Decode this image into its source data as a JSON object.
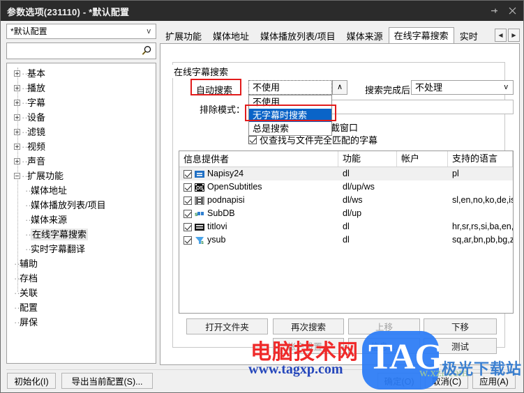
{
  "window": {
    "title": "参数选项(231110) - *默认配置",
    "pin_icon": "pin-icon",
    "close_icon": "close-icon"
  },
  "sidebar": {
    "profile_combo": {
      "value": "*默认配置",
      "arrow": "v"
    },
    "search": {
      "placeholder": "",
      "value": "",
      "icon": "search-icon"
    },
    "tree": [
      {
        "label": "基本",
        "expander": "plus",
        "level": 0
      },
      {
        "label": "播放",
        "expander": "plus",
        "level": 0
      },
      {
        "label": "字幕",
        "expander": "plus",
        "level": 0
      },
      {
        "label": "设备",
        "expander": "plus",
        "level": 0
      },
      {
        "label": "滤镜",
        "expander": "plus",
        "level": 0
      },
      {
        "label": "视频",
        "expander": "plus",
        "level": 0
      },
      {
        "label": "声音",
        "expander": "plus",
        "level": 0
      },
      {
        "label": "扩展功能",
        "expander": "minus",
        "level": 0
      },
      {
        "label": "媒体地址",
        "expander": "none",
        "level": 1
      },
      {
        "label": "媒体播放列表/项目",
        "expander": "none",
        "level": 1
      },
      {
        "label": "媒体来源",
        "expander": "none",
        "level": 1
      },
      {
        "label": "在线字幕搜索",
        "expander": "none",
        "level": 1,
        "selected": true
      },
      {
        "label": "实时字幕翻译",
        "expander": "none",
        "level": 1
      },
      {
        "label": "辅助",
        "expander": "none",
        "level": 0
      },
      {
        "label": "存档",
        "expander": "none",
        "level": 0
      },
      {
        "label": "关联",
        "expander": "none",
        "level": 0
      },
      {
        "label": "配置",
        "expander": "none",
        "level": 0
      },
      {
        "label": "屏保",
        "expander": "none",
        "level": 0
      }
    ]
  },
  "tabs": {
    "items": [
      {
        "label": "扩展功能",
        "active": false
      },
      {
        "label": "媒体地址",
        "active": false
      },
      {
        "label": "媒体播放列表/项目",
        "active": false
      },
      {
        "label": "媒体来源",
        "active": false
      },
      {
        "label": "在线字幕搜索",
        "active": true
      },
      {
        "label": "实时",
        "active": false
      }
    ],
    "scroll_left": "◀",
    "scroll_right": "▶"
  },
  "panel": {
    "group_title": "在线字幕搜索",
    "auto_search_label": "自动搜索",
    "auto_search_value": "不使用",
    "auto_search_arrow": "∧",
    "after_search_label": "搜索完成后：",
    "after_search_value": "不处理",
    "after_search_arrow": "v",
    "exclude_label": "排除模式：",
    "exclude_value": "",
    "partial_text": "截窗口",
    "exact_match_label": "仅查找与文件完全匹配的字幕",
    "exact_match_checked": true,
    "dropdown_options": [
      {
        "label": "不使用",
        "selected": false
      },
      {
        "label": "无字幕时搜索",
        "selected": true
      },
      {
        "label": "总是搜索",
        "selected": false
      }
    ]
  },
  "providers": {
    "columns": [
      "信息提供者",
      "功能",
      "帐户",
      "支持的语言"
    ],
    "rows": [
      {
        "checked": true,
        "icon": "napisy24-icon",
        "name": "Napisy24",
        "functions": "dl",
        "account": "",
        "languages": "pl"
      },
      {
        "checked": true,
        "icon": "opensubtitles-icon",
        "name": "OpenSubtitles",
        "functions": "dl/up/ws",
        "account": "",
        "languages": ""
      },
      {
        "checked": true,
        "icon": "podnapisi-icon",
        "name": "podnapisi",
        "functions": "dl/ws",
        "account": "",
        "languages": "sl,en,no,ko,de,is,cs,fr,it,b..."
      },
      {
        "checked": true,
        "icon": "subdb-icon",
        "name": "SubDB",
        "functions": "dl/up",
        "account": "",
        "languages": ""
      },
      {
        "checked": true,
        "icon": "titlovi-icon",
        "name": "titlovi",
        "functions": "dl",
        "account": "",
        "languages": "hr,sr,rs,si,ba,en,mk"
      },
      {
        "checked": true,
        "icon": "ysub-icon",
        "name": "ysub",
        "functions": "dl",
        "account": "",
        "languages": "sq,ar,bn,pb,bg,zh,hr,cs,d..."
      }
    ]
  },
  "actions": {
    "open_folder": "打开文件夹",
    "search_again": "再次搜索",
    "move_up": "上移",
    "move_down": "下移",
    "account_settings": "帐户设置...",
    "info": "信息....",
    "test": "测试"
  },
  "footer": {
    "initialize": "初始化(I)",
    "export_config": "导出当前配置(S)...",
    "ok": "确定(O)",
    "cancel": "取消(C)",
    "apply": "应用(A)"
  },
  "watermarks": {
    "site_name": "电脑技术网",
    "url": "www.tagxp.com",
    "tag": "TAG",
    "download_site": "极光下载站",
    "faint": "w.xzr.com"
  },
  "colors": {
    "titlebar_bg": "#2b2b2b",
    "annotation_red": "#e21b1b",
    "selection_blue": "#0a64c8",
    "watermark_red": "#ef2a2a",
    "watermark_blue": "#2b7cf6"
  }
}
